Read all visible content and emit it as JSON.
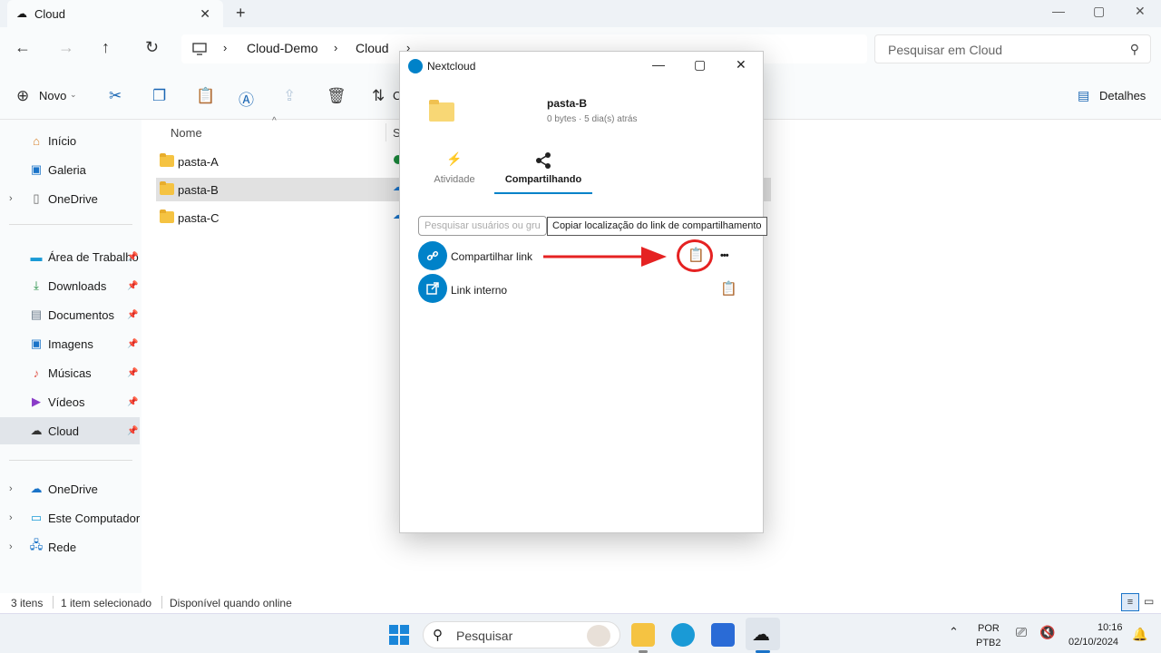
{
  "window": {
    "tab_title": "Cloud",
    "new_tab": "+",
    "minimize": "—",
    "maximize": "▢",
    "close": "✕"
  },
  "address": {
    "breadcrumbs": [
      "Cloud-Demo",
      "Cloud"
    ],
    "search_placeholder": "Pesquisar em Cloud"
  },
  "commandbar": {
    "new_label": "Novo",
    "sort_label": "C",
    "details_label": "Detalhes"
  },
  "sidebar": {
    "items": [
      {
        "label": "Início",
        "icon": "home-icon"
      },
      {
        "label": "Galeria",
        "icon": "gallery-icon"
      },
      {
        "label": "OneDrive",
        "icon": "file-icon"
      },
      {
        "label": "Área de Trabalho",
        "icon": "desktop-icon"
      },
      {
        "label": "Downloads",
        "icon": "download-icon"
      },
      {
        "label": "Documentos",
        "icon": "documents-icon"
      },
      {
        "label": "Imagens",
        "icon": "pictures-icon"
      },
      {
        "label": "Músicas",
        "icon": "music-icon"
      },
      {
        "label": "Vídeos",
        "icon": "videos-icon"
      },
      {
        "label": "Cloud",
        "icon": "cloud-icon"
      },
      {
        "label": "OneDrive",
        "icon": "onedrive-icon"
      },
      {
        "label": "Este Computador",
        "icon": "computer-icon"
      },
      {
        "label": "Rede",
        "icon": "network-icon"
      }
    ]
  },
  "filelist": {
    "col_name": "Nome",
    "col_status": "S",
    "files": [
      {
        "name": "pasta-A"
      },
      {
        "name": "pasta-B"
      },
      {
        "name": "pasta-C"
      }
    ]
  },
  "statusbar": {
    "count": "3 itens",
    "selected": "1 item selecionado",
    "availability": "Disponível quando online"
  },
  "dialog": {
    "title": "Nextcloud",
    "folder_name": "pasta-B",
    "folder_meta": "0 bytes · 5 dia(s) atrás",
    "tab_activity": "Atividade",
    "tab_sharing": "Compartilhando",
    "search_placeholder": "Pesquisar usuários ou grupos",
    "tooltip": "Copiar localização do link de compartilhamento",
    "share_link_label": "Compartilhar link",
    "internal_link_label": "Link interno",
    "more": "•••"
  },
  "taskbar": {
    "search_label": "Pesquisar",
    "lang_top": "POR",
    "lang_bottom": "PTB2",
    "time": "10:16",
    "date": "02/10/2024"
  },
  "colors": {
    "accent": "#0082c9",
    "arrow": "#e52222",
    "folder": "#f5c342"
  }
}
